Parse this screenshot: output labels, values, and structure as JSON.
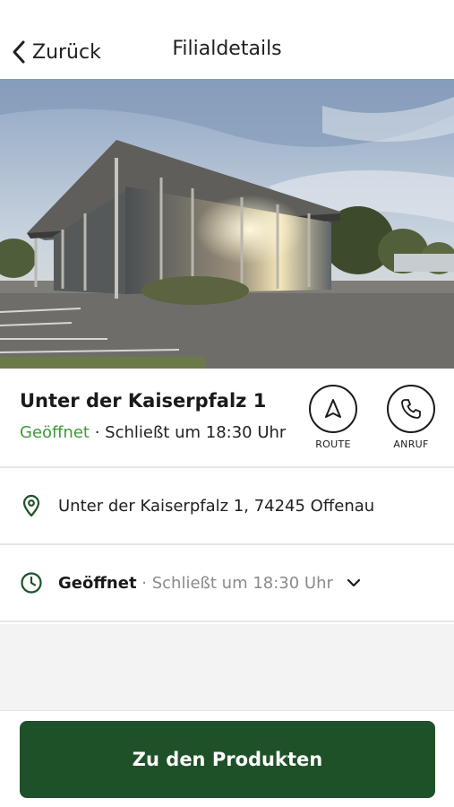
{
  "header": {
    "back_label": "Zurück",
    "title": "Filialdetails"
  },
  "store": {
    "name": "Unter der Kaiserpfalz 1",
    "status_open": "Geöffnet",
    "status_separator": " · ",
    "closing_text": "Schließt um 18:30 Uhr",
    "actions": [
      {
        "label": "ROUTE",
        "icon": "navigation-arrow-icon"
      },
      {
        "label": "ANRUF",
        "icon": "phone-icon"
      }
    ]
  },
  "address": {
    "icon": "location-pin-icon",
    "text": "Unter der Kaiserpfalz 1, 74245 Offenau"
  },
  "hours": {
    "icon": "clock-icon",
    "open_label": "Geöffnet",
    "separator": " · ",
    "closing_text": "Schließt um 18:30 Uhr"
  },
  "cta": {
    "label": "Zu den Produkten"
  },
  "colors": {
    "accent_green": "#3e9a3a",
    "button_green": "#1f5128",
    "icon_green": "#1f5128"
  }
}
